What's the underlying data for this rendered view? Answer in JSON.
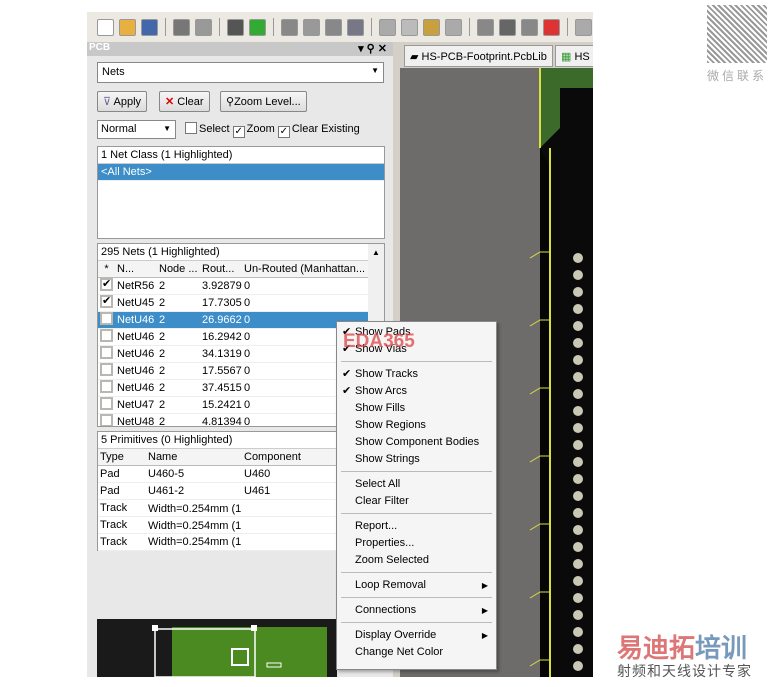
{
  "toolbar": {
    "icons": [
      "new-icon",
      "open-icon",
      "save-icon",
      "print-icon",
      "print-preview-icon",
      "layers-icon",
      "board-icon",
      "zoom-fit-icon",
      "zoom-area-icon",
      "zoom-select-icon",
      "zoom-filter-icon",
      "cut-icon",
      "copy-icon",
      "paste-icon",
      "rubber-stamp-icon",
      "select-rect-icon",
      "move-icon",
      "deselect-icon",
      "clear-icon",
      "undo-icon"
    ]
  },
  "panel": {
    "title": "PCB",
    "mode": "Nets",
    "apply": "Apply",
    "clear": "Clear",
    "zoom_level": "Zoom Level...",
    "mask_mode": "Normal",
    "select_label": "Select",
    "zoom_label": "Zoom",
    "clear_existing_label": "Clear Existing",
    "select_checked": false,
    "zoom_checked": true,
    "clear_existing_checked": true
  },
  "net_classes": {
    "header": "1 Net Class (1 Highlighted)",
    "items": [
      "<All Nets>"
    ]
  },
  "nets": {
    "header": "295 Nets (1 Highlighted)",
    "columns": [
      "*",
      "N...",
      "Node ...",
      "Rout...",
      "Un-Routed (Manhattan..."
    ],
    "rows": [
      {
        "checked": true,
        "name": "NetR56",
        "nodes": "2",
        "routed": "3.92879",
        "unrouted": "0"
      },
      {
        "checked": true,
        "name": "NetU45",
        "nodes": "2",
        "routed": "17.7305",
        "unrouted": "0"
      },
      {
        "checked": false,
        "name": "NetU46",
        "nodes": "2",
        "routed": "26.9662",
        "unrouted": "0",
        "selected": true
      },
      {
        "checked": false,
        "name": "NetU46",
        "nodes": "2",
        "routed": "16.2942",
        "unrouted": "0"
      },
      {
        "checked": false,
        "name": "NetU46",
        "nodes": "2",
        "routed": "34.1319",
        "unrouted": "0"
      },
      {
        "checked": false,
        "name": "NetU46",
        "nodes": "2",
        "routed": "17.5567",
        "unrouted": "0"
      },
      {
        "checked": false,
        "name": "NetU46",
        "nodes": "2",
        "routed": "37.4515",
        "unrouted": "0"
      },
      {
        "checked": false,
        "name": "NetU47",
        "nodes": "2",
        "routed": "15.2421",
        "unrouted": "0"
      },
      {
        "checked": false,
        "name": "NetU48",
        "nodes": "2",
        "routed": "4.81394",
        "unrouted": "0"
      }
    ]
  },
  "primitives": {
    "header": "5 Primitives (0 Highlighted)",
    "columns": [
      "Type",
      "Name",
      "Component"
    ],
    "rows": [
      [
        "Pad",
        "U460-5",
        "U460"
      ],
      [
        "Pad",
        "U461-2",
        "U461"
      ],
      [
        "Track",
        "Width=0.254mm (1․",
        ""
      ],
      [
        "Track",
        "Width=0.254mm (1․",
        ""
      ],
      [
        "Track",
        "Width=0.254mm (1!",
        ""
      ]
    ]
  },
  "tabs": [
    {
      "label": "HS-PCB-Footprint.PcbLib"
    },
    {
      "label": "HS"
    }
  ],
  "context_menu": {
    "groups": [
      [
        {
          "label": "Show Pads",
          "checked": true
        },
        {
          "label": "Show Vias",
          "checked": true
        }
      ],
      [
        {
          "label": "Show Tracks",
          "checked": true
        },
        {
          "label": "Show Arcs",
          "checked": true
        },
        {
          "label": "Show Fills"
        },
        {
          "label": "Show Regions"
        },
        {
          "label": "Show Component Bodies"
        },
        {
          "label": "Show Strings"
        }
      ],
      [
        {
          "label": "Select All"
        },
        {
          "label": "Clear Filter"
        }
      ],
      [
        {
          "label": "Report..."
        },
        {
          "label": "Properties..."
        },
        {
          "label": "Zoom Selected"
        }
      ],
      [
        {
          "label": "Loop Removal",
          "submenu": true
        }
      ],
      [
        {
          "label": "Connections",
          "submenu": true
        }
      ],
      [
        {
          "label": "Display Override",
          "submenu": true
        },
        {
          "label": "Change Net Color"
        }
      ]
    ]
  },
  "watermarks": {
    "eda": "EDA365",
    "qr_caption": "微信联系",
    "brand": "易迪拓培训",
    "brand_sub": "射频和天线设计专家"
  },
  "colors": {
    "selection": "#3c8dc8",
    "board_green": "#2d5a1e",
    "pad": "#c8c8b4",
    "outline": "#d8e040"
  }
}
